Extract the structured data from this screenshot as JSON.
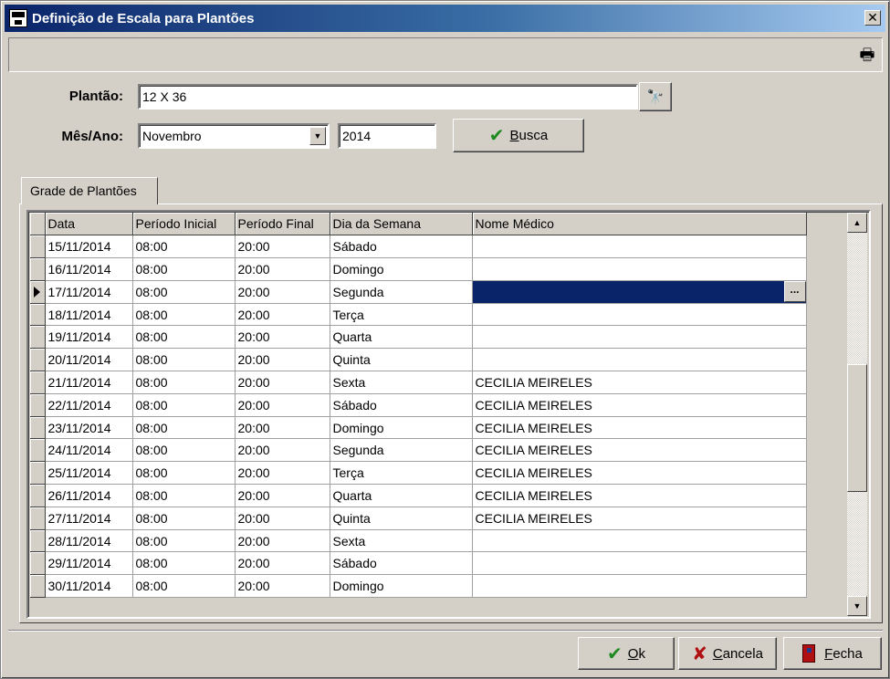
{
  "window": {
    "title": "Definição de Escala para Plantões",
    "close_label": "✕"
  },
  "form": {
    "plantao_label": "Plantão:",
    "plantao_value": "12 X 36",
    "mesano_label": "Mês/Ano:",
    "mes_value": "Novembro",
    "ano_value": "2014",
    "busca_accel": "B",
    "busca_rest": "usca"
  },
  "tab": {
    "label": "Grade de Plantões"
  },
  "grid": {
    "columns": [
      "Data",
      "Período Inicial",
      "Período Final",
      "Dia da Semana",
      "Nome Médico"
    ],
    "rows": [
      [
        "15/11/2014",
        "08:00",
        "20:00",
        "Sábado",
        ""
      ],
      [
        "16/11/2014",
        "08:00",
        "20:00",
        "Domingo",
        ""
      ],
      [
        "17/11/2014",
        "08:00",
        "20:00",
        "Segunda",
        ""
      ],
      [
        "18/11/2014",
        "08:00",
        "20:00",
        "Terça",
        ""
      ],
      [
        "19/11/2014",
        "08:00",
        "20:00",
        "Quarta",
        ""
      ],
      [
        "20/11/2014",
        "08:00",
        "20:00",
        "Quinta",
        ""
      ],
      [
        "21/11/2014",
        "08:00",
        "20:00",
        "Sexta",
        "CECILIA MEIRELES"
      ],
      [
        "22/11/2014",
        "08:00",
        "20:00",
        "Sábado",
        "CECILIA MEIRELES"
      ],
      [
        "23/11/2014",
        "08:00",
        "20:00",
        "Domingo",
        "CECILIA MEIRELES"
      ],
      [
        "24/11/2014",
        "08:00",
        "20:00",
        "Segunda",
        "CECILIA MEIRELES"
      ],
      [
        "25/11/2014",
        "08:00",
        "20:00",
        "Terça",
        "CECILIA MEIRELES"
      ],
      [
        "26/11/2014",
        "08:00",
        "20:00",
        "Quarta",
        "CECILIA MEIRELES"
      ],
      [
        "27/11/2014",
        "08:00",
        "20:00",
        "Quinta",
        "CECILIA MEIRELES"
      ],
      [
        "28/11/2014",
        "08:00",
        "20:00",
        "Sexta",
        ""
      ],
      [
        "29/11/2014",
        "08:00",
        "20:00",
        "Sábado",
        ""
      ],
      [
        "30/11/2014",
        "08:00",
        "20:00",
        "Domingo",
        ""
      ]
    ],
    "current_row": 2,
    "ellipsis_label": "..."
  },
  "buttons": {
    "ok_accel": "O",
    "ok_rest": "k",
    "cancela_accel": "C",
    "cancela_rest": "ancela",
    "fecha_accel": "F",
    "fecha_rest": "echa"
  },
  "icons": {
    "window": "app-window-icon",
    "printer": "printer-icon",
    "search": "binoculars-icon",
    "check": "checkmark-icon",
    "cancel": "x-icon",
    "close": "door-icon"
  },
  "colors": {
    "titlebar": "#0a246a",
    "selection": "#0a246a",
    "face": "#d4d0c8"
  }
}
